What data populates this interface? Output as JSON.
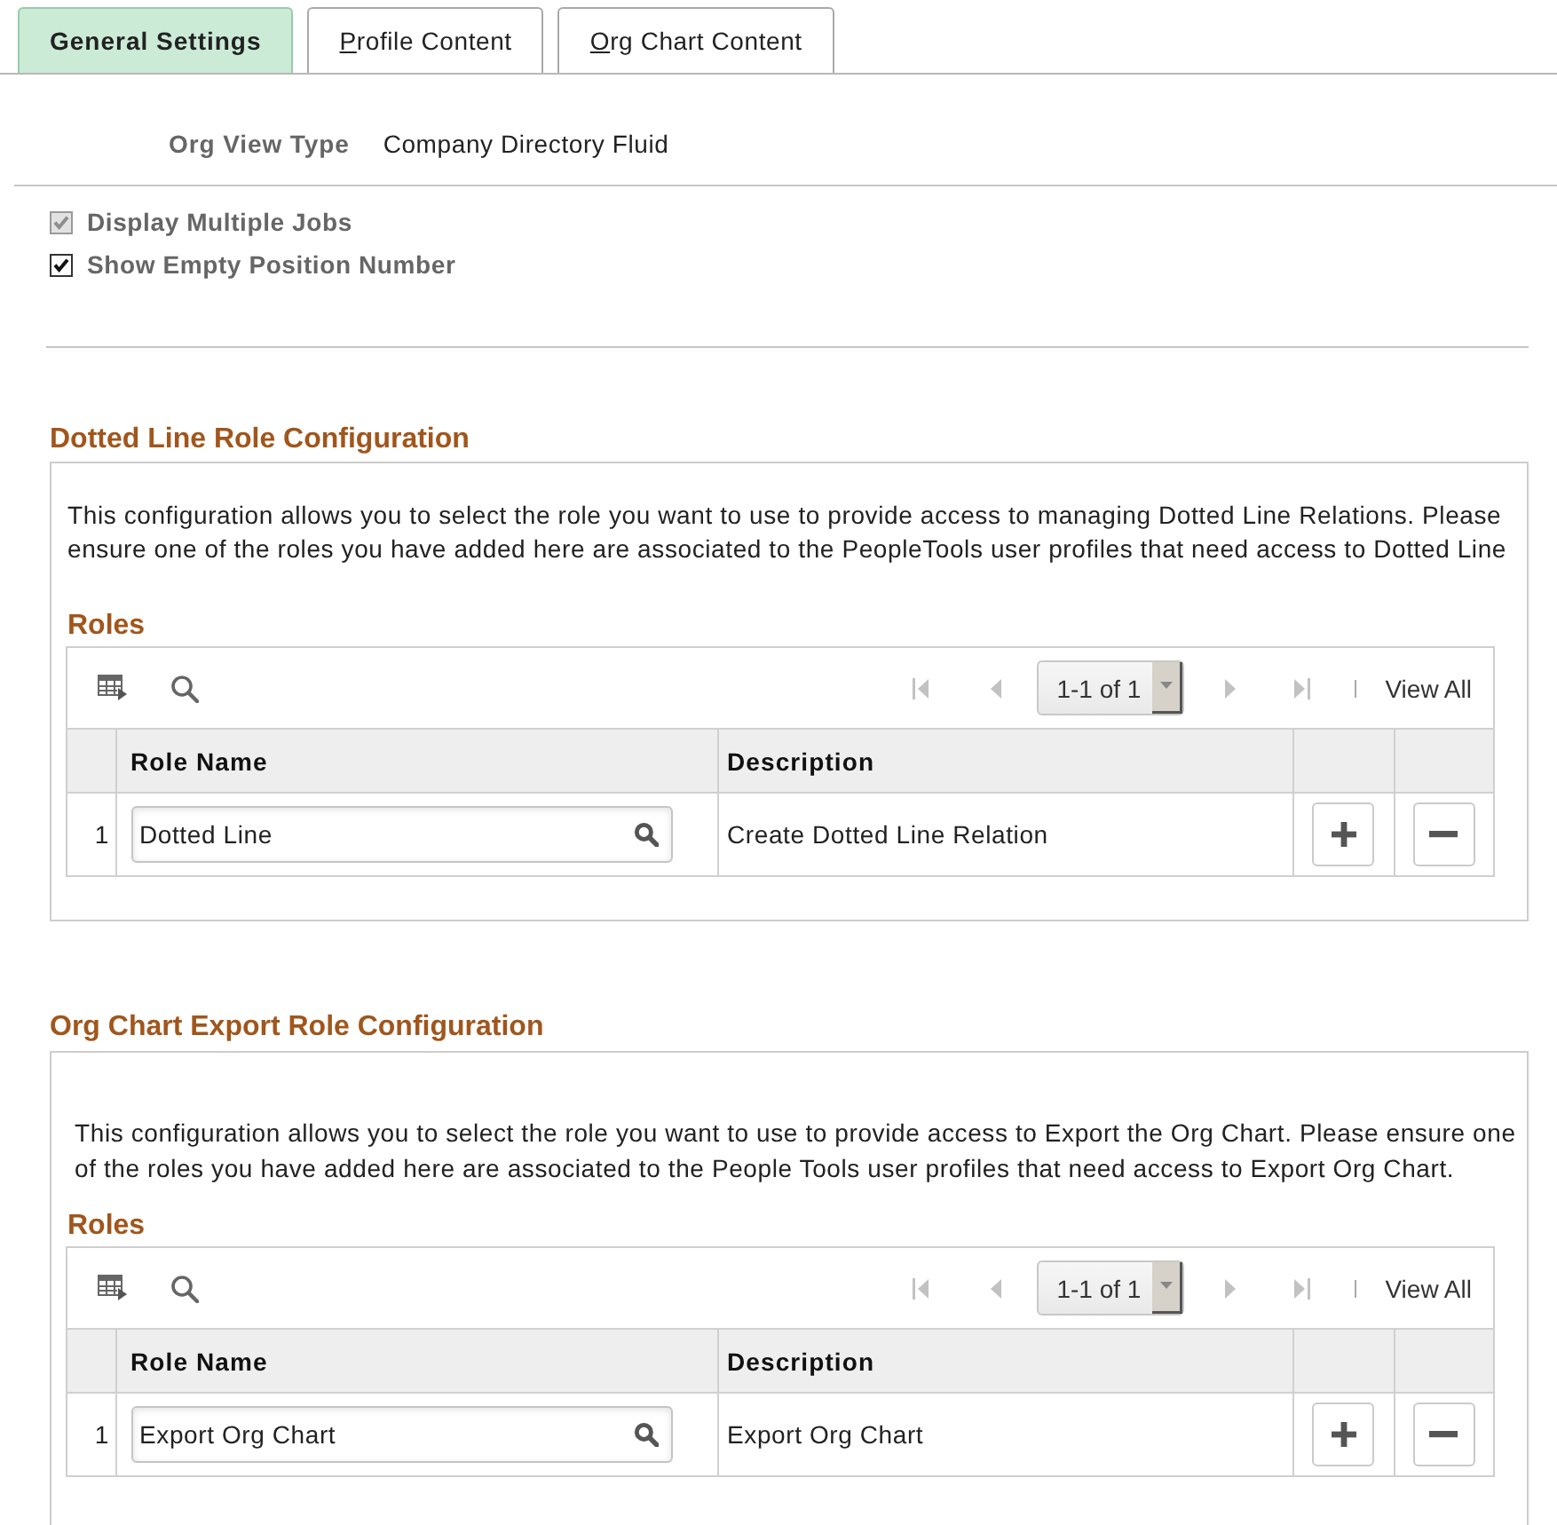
{
  "tabs": [
    {
      "label": "General Settings",
      "selected": true,
      "shortcut_underlined": false
    },
    {
      "label": "Profile Content",
      "selected": false,
      "shortcut_underlined": true
    },
    {
      "label": "Org Chart Content",
      "selected": false,
      "shortcut_underlined": true
    }
  ],
  "org_view_type": {
    "label": "Org View Type",
    "value": "Company Directory Fluid"
  },
  "options": [
    {
      "label": "Display Multiple Jobs",
      "checked": true,
      "disabled": true
    },
    {
      "label": "Show Empty Position Number",
      "checked": true,
      "disabled": false
    }
  ],
  "sections": [
    {
      "title": "Dotted Line Role Configuration",
      "description": "This configuration allows you to select the role you want to use to provide access to managing Dotted Line Relations. Please ensure one of the roles you have added here are associated to the PeopleTools user profiles that need access to Dotted Line",
      "grid": {
        "title": "Roles",
        "pager": {
          "nav": [
            {
              "kind": "first",
              "disabled": true
            },
            {
              "kind": "previous",
              "disabled": true
            },
            {
              "kind": "next",
              "disabled": true
            },
            {
              "kind": "last",
              "disabled": true
            }
          ],
          "range": "1-1 of 1",
          "view_all": "View All"
        },
        "columns": [
          "Role Name",
          "Description"
        ],
        "rows": [
          {
            "number": "1",
            "role_name": "Dotted Line",
            "description": "Create Dotted Line Relation"
          }
        ]
      }
    },
    {
      "title": "Org Chart Export Role Configuration",
      "description": "This configuration allows you to select the role you want to use to provide access to Export the Org Chart. Please ensure one of the roles you have added here are associated to the People Tools user profiles that need access to Export Org Chart.",
      "grid": {
        "title": "Roles",
        "pager": {
          "nav": [
            {
              "kind": "first",
              "disabled": true
            },
            {
              "kind": "previous",
              "disabled": true
            },
            {
              "kind": "next",
              "disabled": true
            },
            {
              "kind": "last",
              "disabled": true
            }
          ],
          "range": "1-1 of 1",
          "view_all": "View All"
        },
        "columns": [
          "Role Name",
          "Description"
        ],
        "rows": [
          {
            "number": "1",
            "role_name": "Export Org Chart",
            "description": "Export Org Chart"
          }
        ]
      }
    }
  ]
}
